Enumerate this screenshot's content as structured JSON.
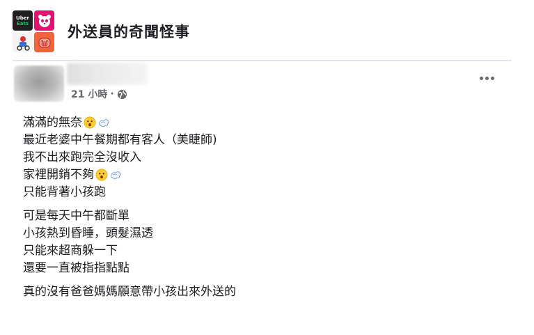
{
  "group": {
    "name": "外送員的奇聞怪事",
    "logo_tiles": {
      "uber_top": "Uber",
      "uber_bottom": "Eats"
    }
  },
  "post": {
    "time": "21 小時",
    "separator": "·",
    "privacy_icon": "globe-icon",
    "menu_icon": "more-options-icon",
    "paragraphs": [
      {
        "lines": [
          {
            "text": "滿滿的無奈",
            "emojis": [
              "hushed-face-emoji",
              "dash-emoji"
            ]
          },
          {
            "text": "最近老婆中午餐期都有客人（美睫師)"
          },
          {
            "text": "我不出來跑完全沒收入"
          },
          {
            "text": "家裡開銷不夠",
            "emojis": [
              "hushed-face-emoji",
              "dash-emoji"
            ]
          },
          {
            "text": "只能背著小孩跑"
          }
        ]
      },
      {
        "lines": [
          {
            "text": "可是每天中午都斷單"
          },
          {
            "text": "小孩熱到昏睡，頭髮濕透"
          },
          {
            "text": "只能來超商躲一下"
          },
          {
            "text": "還要一直被指指點點"
          }
        ]
      },
      {
        "lines": [
          {
            "text": "真的沒有爸爸媽媽願意帶小孩出來外送的"
          }
        ]
      }
    ]
  },
  "colors": {
    "text": "#1c1e21",
    "meta": "#65676b",
    "divider": "#e4e6eb",
    "uber_green": "#06c167",
    "foodpanda_pink": "#e2136e"
  }
}
